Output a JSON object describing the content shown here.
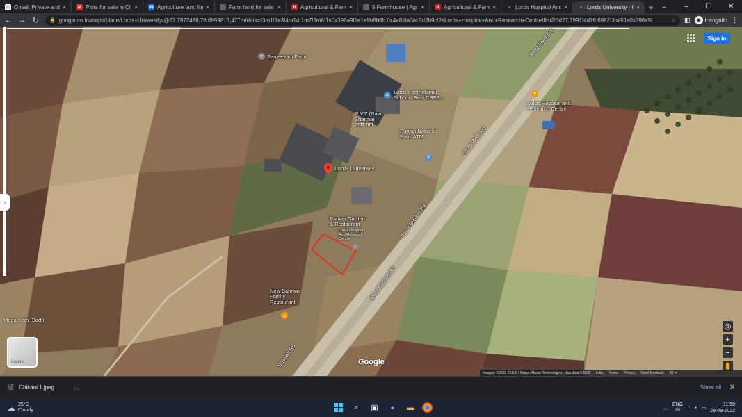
{
  "tabs": [
    {
      "title": "Gmail: Private and se",
      "icon": "google-icon",
      "color": "#ea4335"
    },
    {
      "title": "Plots for sale in Chiko",
      "icon": "magicbricks-icon",
      "color": "#d93025"
    },
    {
      "title": "Agriculture land for sa",
      "icon": "99acres-icon",
      "color": "#1a73e8"
    },
    {
      "title": "Farm land for sale in",
      "icon": "page-icon",
      "color": "#5f6368"
    },
    {
      "title": "Agricultural & Farm la",
      "icon": "housing-icon",
      "color": "#c5221f"
    },
    {
      "title": "5 Farmhouse | Agricult",
      "icon": "page-icon",
      "color": "#5f6368"
    },
    {
      "title": "Agricultural & Farm la",
      "icon": "housing-icon",
      "color": "#c5221f"
    },
    {
      "title": "Lords Hospital And Re",
      "icon": "maps-icon",
      "color": "#34a853"
    },
    {
      "title": "Lords University - Goo",
      "icon": "maps-icon",
      "color": "#34a853",
      "active": true
    }
  ],
  "toolbar": {
    "url": "google.co.in/maps/place/Lords+University/@27.7972488,76.6959813,477m/data=!3m1!1e3!4m14!1m7!3m6!1s0x396a9f1e1e9b6b6b:0x4e8fda3ec2d2b9c!2sLords+Hospital+And+Research+Centre!8m2!3d27.7991!4d76.6982!3m5!1s0x396a9f",
    "incognito_label": "Incognito"
  },
  "map": {
    "signin_label": "Sign in",
    "main_place": "Lords University",
    "google_logo": "Google",
    "layers_label": "Layers",
    "attribution": [
      "Imagery ©2022 CNES / Airbus, Maxar Technologies, Map data ©2022",
      "India",
      "Terms",
      "Privacy",
      "Send feedback",
      "50 m"
    ],
    "labels": [
      {
        "text": "Sanjeevani Farm",
        "id": "sanjeevani"
      },
      {
        "text": "Lords International School | Best CBSE...",
        "id": "lords-school"
      },
      {
        "text": "R.V.Z.(Ravi Sharma) नार्की मार्ग",
        "id": "rvz"
      },
      {
        "text": "Punjab National Bank ATM",
        "id": "pnb-atm"
      },
      {
        "text": "Parivar Garden & Restaurant",
        "id": "parivar-garden"
      },
      {
        "text": "Lords Hospital And Research Centre",
        "id": "lords-hospital"
      },
      {
        "text": "Lords Hospital and Research Centre",
        "id": "lords-hospital-2"
      },
      {
        "text": "New Bahrain Family Restaurant",
        "id": "new-bahrain"
      },
      {
        "text": "Majra Kath (Badi)",
        "id": "majra"
      },
      {
        "text": "अलवर-दिल्ली मार्ग",
        "id": "hindi-road"
      },
      {
        "text": "Alwar Bypass Rd",
        "id": "alwar-bypass"
      },
      {
        "text": "Alwar Bypass Rd",
        "id": "alwar-bypass-2"
      },
      {
        "text": "Bhiwadi Rd",
        "id": "bhiwadi"
      },
      {
        "text": "अलवर-दिल्ली मार्ग",
        "id": "hindi-road-2"
      }
    ]
  },
  "download": {
    "file_name": "Chikani 1.jpeg",
    "show_all": "Show all"
  },
  "taskbar": {
    "weather_temp": "25°C",
    "weather_desc": "Cloudy",
    "lang_top": "ENG",
    "lang_bottom": "IN",
    "time": "11:50",
    "date": "28-09-2022"
  },
  "colors": {
    "accent": "#1a73e8",
    "pin_red": "#ea4335",
    "plot_outline": "#ff1a1a"
  }
}
